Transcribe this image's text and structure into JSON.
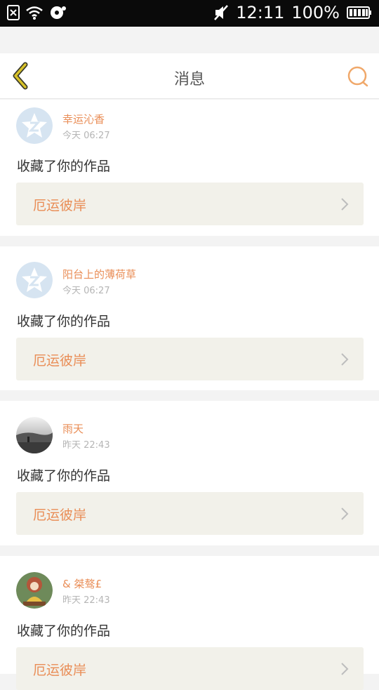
{
  "status_bar": {
    "time": "12:11",
    "battery": "100%",
    "icons": [
      "notification-x-icon",
      "wifi-icon",
      "record-icon",
      "mute-icon",
      "battery-icon"
    ]
  },
  "header": {
    "title": "消息",
    "back_icon": "back-chevron-icon",
    "search_icon": "search-icon"
  },
  "colors": {
    "accent": "#e98d56",
    "back": "#c8b026",
    "card_work_bg": "#f2f1ea"
  },
  "messages": [
    {
      "user": "幸运沁香",
      "time": "今天 06:27",
      "action": "收藏了你的作品",
      "work": "厄运彼岸",
      "avatar": "default-star-avatar"
    },
    {
      "user": "阳台上的薄荷草",
      "time": "今天 06:27",
      "action": "收藏了你的作品",
      "work": "厄运彼岸",
      "avatar": "default-star-avatar"
    },
    {
      "user": "雨天",
      "time": "昨天 22:43",
      "action": "收藏了你的作品",
      "work": "厄运彼岸",
      "avatar": "photo-avatar"
    },
    {
      "user": "& 桀骜£",
      "time": "昨天 22:43",
      "action": "收藏了你的作品",
      "work": "厄运彼岸",
      "avatar": "illustrated-avatar"
    }
  ]
}
